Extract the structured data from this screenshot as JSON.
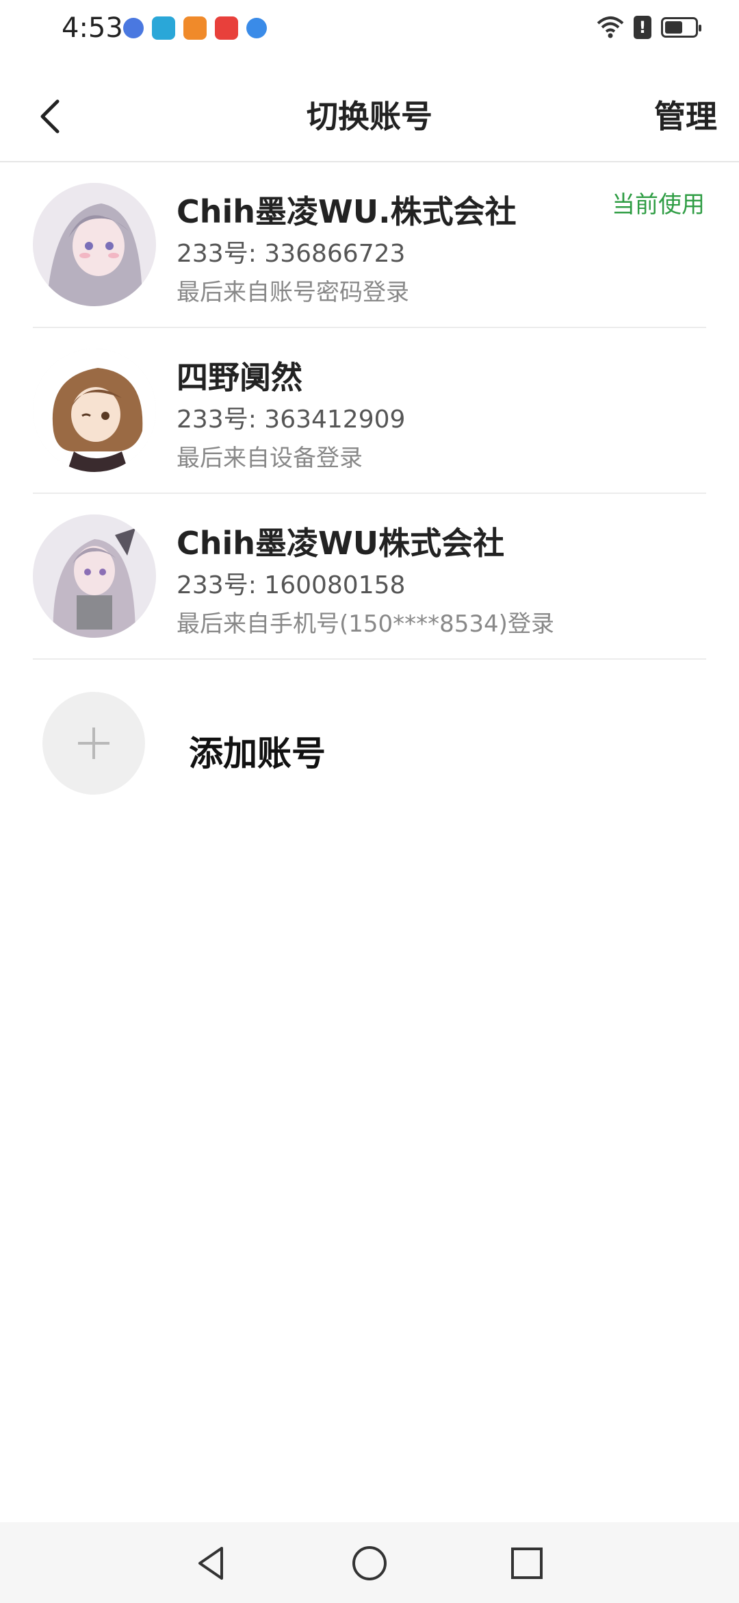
{
  "status_bar": {
    "time": "4:53",
    "notification_icons": [
      "music-icon",
      "book-icon",
      "video-play-icon",
      "store-icon",
      "browser-icon"
    ],
    "battery_level": 0.6
  },
  "header": {
    "title": "切换账号",
    "manage": "管理"
  },
  "accounts": [
    {
      "name": "Chih墨凌WU.株式会社",
      "id": "233号: 336866723",
      "last_login": "最后来自账号密码登录",
      "current": "当前使用"
    },
    {
      "name": "四野阒然",
      "id": "233号: 363412909",
      "last_login": "最后来自设备登录"
    },
    {
      "name": "Chih墨凌WU株式会社",
      "id": "233号: 160080158",
      "last_login": "最后来自手机号(150****8534)登录"
    }
  ],
  "add_account": {
    "label": "添加账号"
  },
  "colors": {
    "accent_green": "#2f9d44",
    "text_primary": "#222222",
    "text_secondary": "#888888"
  }
}
